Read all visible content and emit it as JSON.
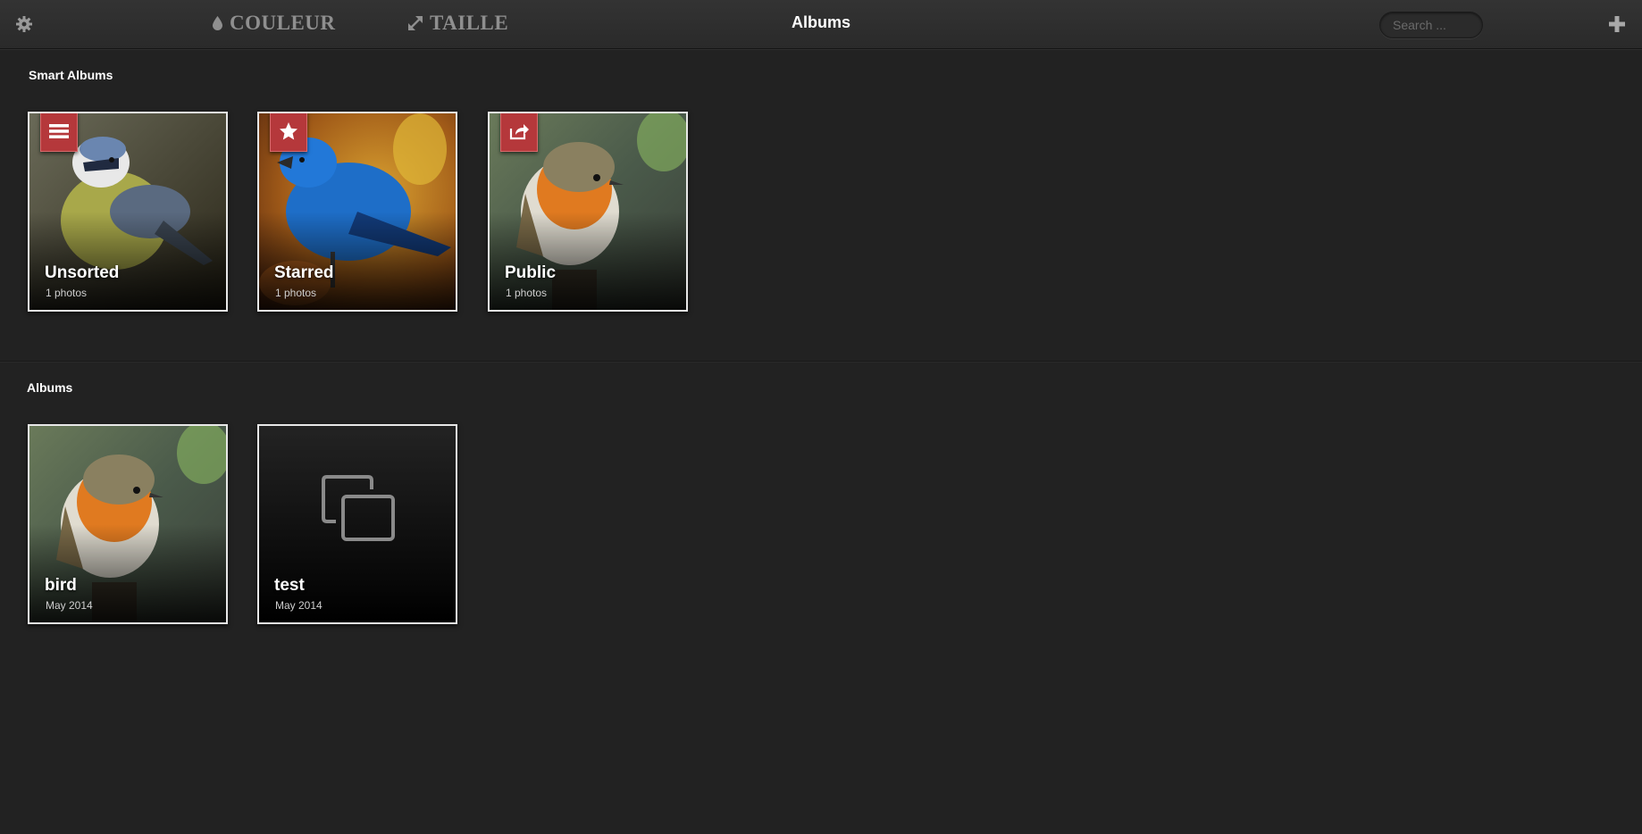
{
  "header": {
    "title": "Albums",
    "tools": [
      {
        "label": "COULEUR",
        "icon": "droplet-icon"
      },
      {
        "label": "TAILLE",
        "icon": "resize-arrows-icon"
      }
    ],
    "search_placeholder": "Search ...",
    "settings_icon": "gear-icon",
    "add_icon": "plus-icon"
  },
  "smart_albums": {
    "title": "Smart Albums",
    "items": [
      {
        "name": "Unsorted",
        "subtitle": "1 photos",
        "badge_icon": "list-icon"
      },
      {
        "name": "Starred",
        "subtitle": "1 photos",
        "badge_icon": "star-icon"
      },
      {
        "name": "Public",
        "subtitle": "1 photos",
        "badge_icon": "share-icon"
      }
    ]
  },
  "albums": {
    "title": "Albums",
    "items": [
      {
        "name": "bird",
        "subtitle": "May 2014"
      },
      {
        "name": "test",
        "subtitle": "May 2014",
        "thumb_icon": "album-placeholder-icon"
      }
    ]
  },
  "colors": {
    "background": "#222222",
    "badge": "#b5383b",
    "border": "#e8e8e8"
  }
}
